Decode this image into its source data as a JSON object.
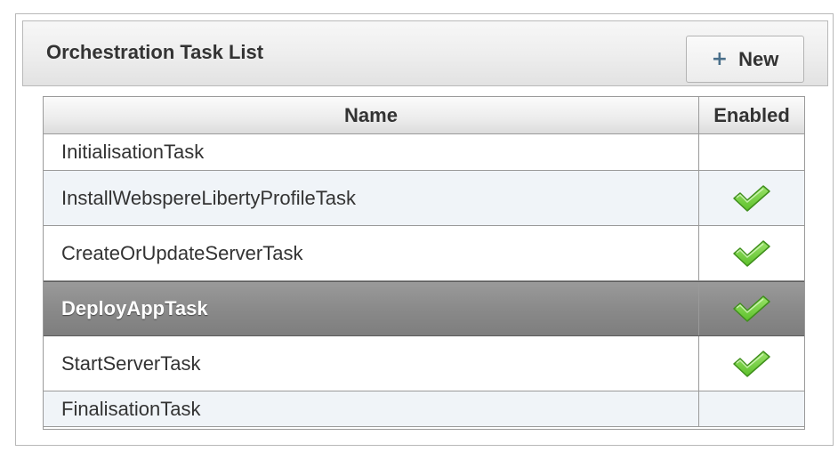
{
  "panel": {
    "title": "Orchestration Task List",
    "new_button_icon": "plus-icon",
    "new_button_label": "New"
  },
  "grid": {
    "columns": [
      "Name",
      "Enabled"
    ],
    "rows": [
      {
        "name": "InitialisationTask",
        "enabled": false,
        "selected": false
      },
      {
        "name": "InstallWebspereLibertyProfileTask",
        "enabled": true,
        "selected": false
      },
      {
        "name": "CreateOrUpdateServerTask",
        "enabled": true,
        "selected": false
      },
      {
        "name": "DeployAppTask",
        "enabled": true,
        "selected": true
      },
      {
        "name": "StartServerTask",
        "enabled": true,
        "selected": false
      },
      {
        "name": "FinalisationTask",
        "enabled": false,
        "selected": false
      }
    ],
    "check_icon": "checkmark-icon",
    "check_color": "#5cc02a"
  }
}
